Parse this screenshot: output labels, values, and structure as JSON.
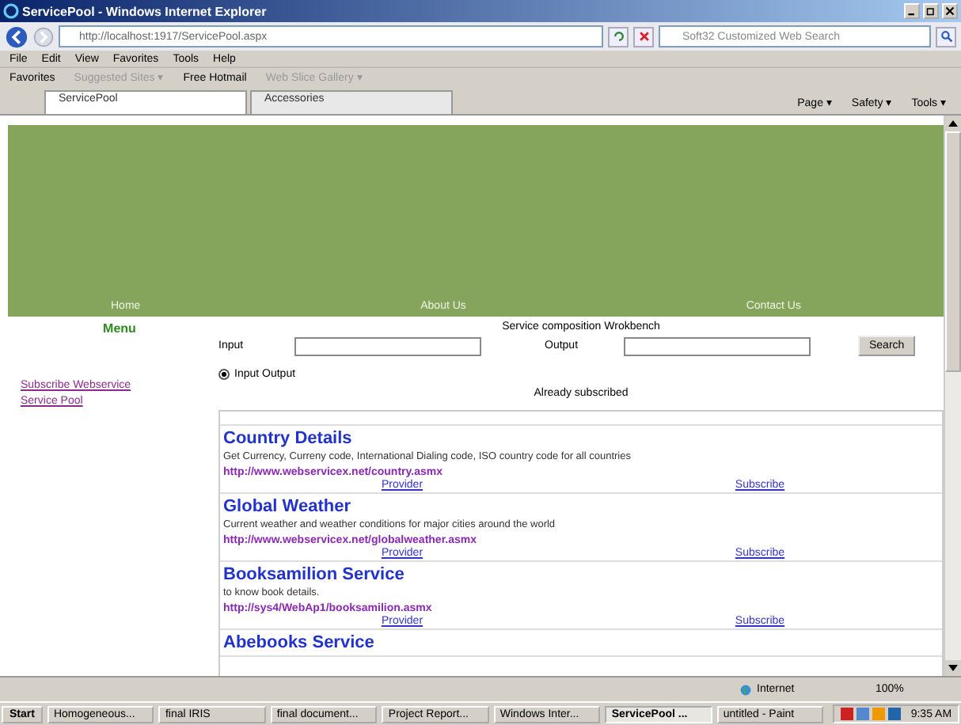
{
  "window": {
    "title": "ServicePool - Windows Internet Explorer"
  },
  "address": {
    "url": "http://localhost:1917/ServicePool.aspx"
  },
  "search": {
    "placeholder": "Soft32 Customized Web Search"
  },
  "menu_bar": [
    "File",
    "Edit",
    "View",
    "Favorites",
    "Tools",
    "Help"
  ],
  "favorites_bar": {
    "label": "Favorites",
    "items": [
      {
        "label": "Suggested Sites ▾",
        "disabled": true
      },
      {
        "label": "Free Hotmail",
        "disabled": false
      },
      {
        "label": "Web Slice Gallery ▾",
        "disabled": true
      }
    ]
  },
  "tabs": [
    {
      "label": "ServicePool",
      "selected": true
    },
    {
      "label": "Accessories",
      "selected": false
    }
  ],
  "command_bar": [
    "Page ▾",
    "Safety ▾",
    "Tools ▾"
  ],
  "page": {
    "nav": [
      "Home",
      "About Us",
      "Contact Us"
    ],
    "sidebar": {
      "title": "Menu",
      "links": [
        "Subscribe Webservice",
        "Service Pool"
      ]
    },
    "workbench": {
      "title": "Service composition Wrokbench",
      "input_label": "Input",
      "output_label": "Output",
      "search_button": "Search",
      "radio": {
        "label": "Input Output",
        "selected": true
      }
    },
    "subscribed_title": "Already subscribed",
    "services": [
      {
        "name": "Country Details",
        "description": "Get Currency, Curreny code, International Dialing code, ISO country code for all countries",
        "url": "http://www.webservicex.net/country.asmx",
        "provider": "Provider",
        "subscribe": "Subscribe"
      },
      {
        "name": "Global Weather",
        "description": "Current weather and weather conditions for major cities around the world",
        "url": "http://www.webservicex.net/globalweather.asmx",
        "provider": "Provider",
        "subscribe": "Subscribe"
      },
      {
        "name": "Booksamilion Service",
        "description": "to know book details.",
        "url": "http://sys4/WebAp1/booksamilion.asmx",
        "provider": "Provider",
        "subscribe": "Subscribe"
      },
      {
        "name": "Abebooks Service"
      }
    ]
  },
  "status_bar": {
    "zone": "Internet",
    "zoom": "100%"
  },
  "taskbar": {
    "start": "Start",
    "items": [
      {
        "label": "Homogeneous...",
        "selected": false
      },
      {
        "label": "final IRIS",
        "selected": false
      },
      {
        "label": "final document...",
        "selected": false
      },
      {
        "label": "Project Report...",
        "selected": false
      },
      {
        "label": "Windows Inter...",
        "selected": false
      },
      {
        "label": "ServicePool ...",
        "selected": true
      },
      {
        "label": "untitled - Paint",
        "selected": false
      }
    ],
    "clock": "9:35 AM"
  }
}
